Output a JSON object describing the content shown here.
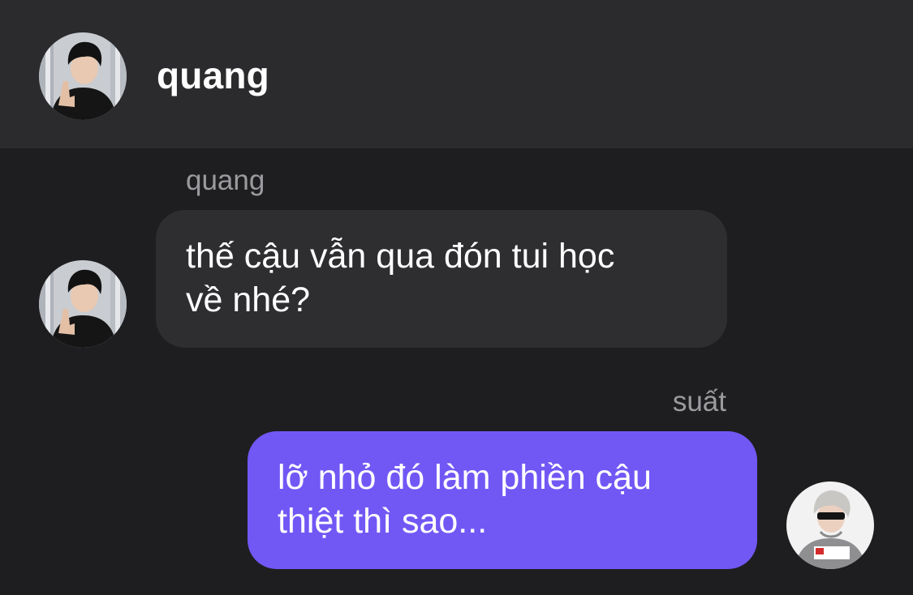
{
  "header": {
    "title": "quang",
    "avatar_icon": "profile-photo-quang"
  },
  "messages": [
    {
      "sender": "quang",
      "direction": "incoming",
      "lines": [
        "thế cậu vẫn qua đón tui học",
        "về nhé?"
      ],
      "avatar_icon": "profile-photo-quang"
    },
    {
      "sender": "suất",
      "direction": "outgoing",
      "lines": [
        "lỡ nhỏ đó làm phiền cậu",
        "thiệt thì sao..."
      ],
      "avatar_icon": "profile-photo-suat"
    }
  ],
  "colors": {
    "background": "#1e1e20",
    "header_background": "#2b2b2d",
    "incoming_bubble": "#2e2e31",
    "outgoing_bubble": "#7158f5",
    "sender_name": "#9b9b9f",
    "text": "#ffffff"
  }
}
